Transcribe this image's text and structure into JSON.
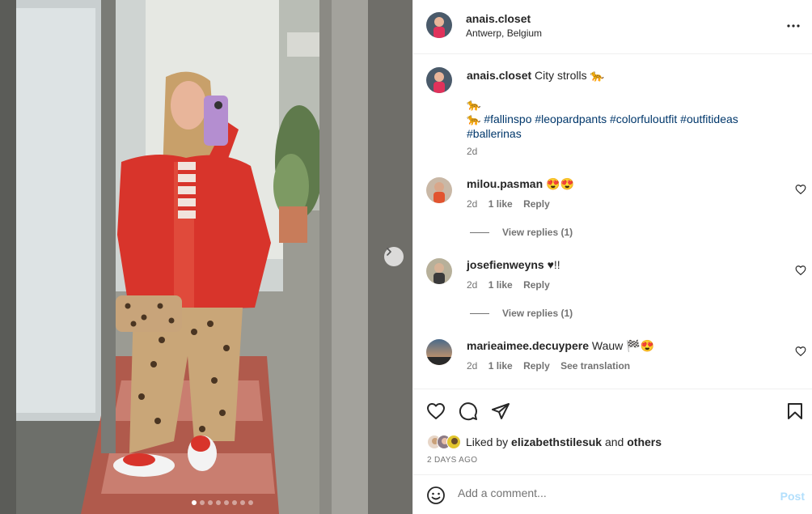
{
  "post": {
    "username": "anais.closet",
    "location": "Antwerp, Belgium"
  },
  "caption": {
    "username": "anais.closet",
    "text": "City strolls 🐆",
    "line2": "🐆",
    "line3_prefix": "🐆",
    "hashtags": "#fallinspo #leopardpants #colorfuloutfit #outfitideas #ballerinas",
    "time": "2d"
  },
  "comments": [
    {
      "username": "milou.pasman",
      "text": "😍😍",
      "time": "2d",
      "likes": "1 like",
      "reply": "Reply",
      "view_replies": "View replies (1)"
    },
    {
      "username": "josefienweyns",
      "text": "♥!!",
      "time": "2d",
      "likes": "1 like",
      "reply": "Reply",
      "view_replies": "View replies (1)"
    },
    {
      "username": "marieaimee.decuypere",
      "text": "Wauw 🏁😍",
      "time": "2d",
      "likes": "1 like",
      "reply": "Reply",
      "see_translation": "See translation"
    }
  ],
  "likes": {
    "prefix": "Liked by",
    "user": "elizabethstilesuk",
    "conj": "and",
    "others": "others"
  },
  "date": "2 DAYS AGO",
  "add_comment": {
    "placeholder": "Add a comment...",
    "post_label": "Post"
  },
  "carousel": {
    "count": 8,
    "active_index": 0
  },
  "icons": {
    "more": "more-options-icon",
    "like": "heart-icon",
    "comment": "comment-icon",
    "share": "share-icon",
    "save": "bookmark-icon",
    "emoji": "emoji-icon",
    "next": "chevron-right-icon"
  },
  "colors": {
    "link": "#00376b",
    "muted": "#737373",
    "post_disabled": "#b2dffc"
  }
}
